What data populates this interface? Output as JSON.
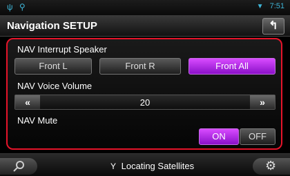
{
  "status": {
    "time": "7:51"
  },
  "title": "Navigation SETUP",
  "interrupt": {
    "label": "NAV Interrupt Speaker",
    "options": [
      "Front L",
      "Front R",
      "Front All"
    ],
    "selected": "Front All"
  },
  "voice": {
    "label": "NAV Voice Volume",
    "decrease": "«",
    "increase": "»",
    "value": "20"
  },
  "mute": {
    "label": "NAV Mute",
    "on": "ON",
    "off": "OFF",
    "selected": "ON"
  },
  "footer": {
    "status_text": "Locating Satellites"
  },
  "colors": {
    "accent": "#b52ee6",
    "frame": "#e6142a",
    "status": "#3fb6d8"
  }
}
